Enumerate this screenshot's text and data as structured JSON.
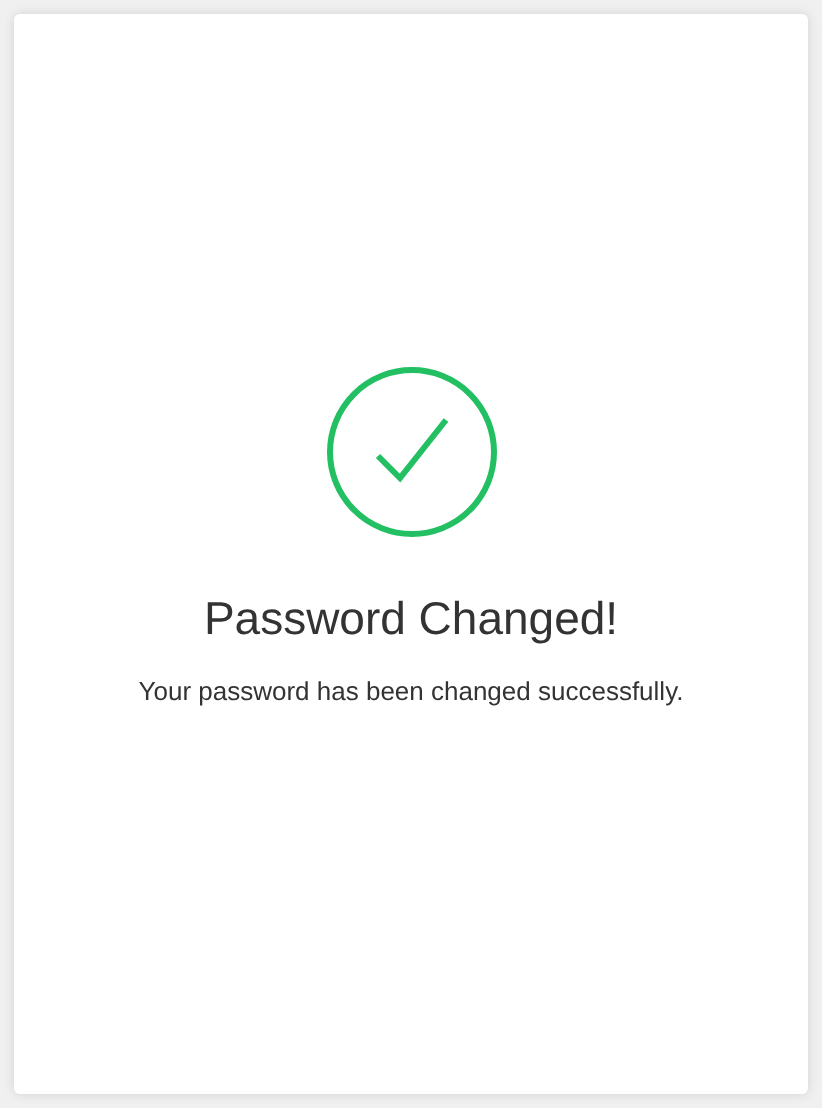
{
  "title": "Password Changed!",
  "message": "Your password has been changed successfully."
}
